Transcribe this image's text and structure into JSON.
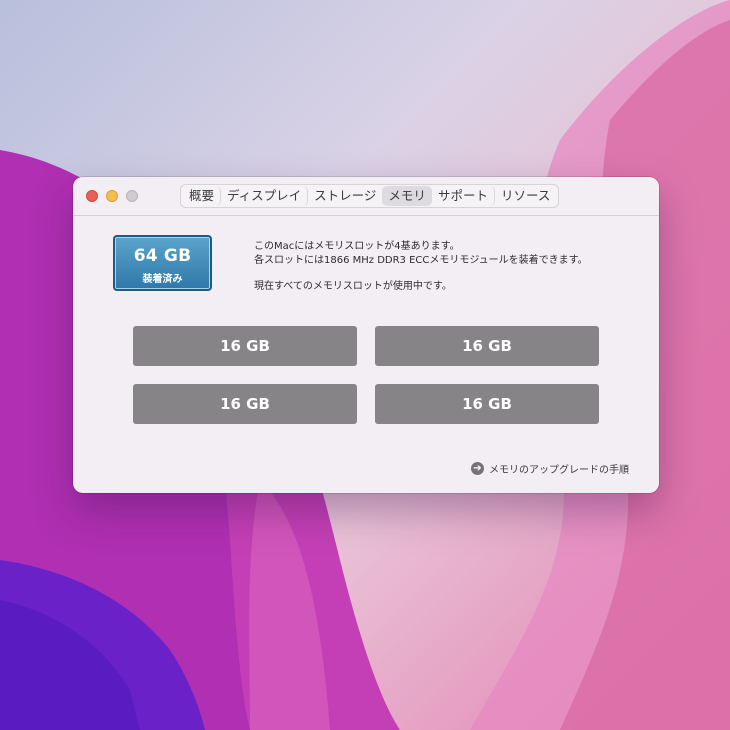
{
  "window": {
    "tabs": [
      {
        "label": "概要",
        "active": false
      },
      {
        "label": "ディスプレイ",
        "active": false
      },
      {
        "label": "ストレージ",
        "active": false
      },
      {
        "label": "メモリ",
        "active": true
      },
      {
        "label": "サポート",
        "active": false
      },
      {
        "label": "リソース",
        "active": false
      }
    ]
  },
  "memory": {
    "total": "64 GB",
    "installed_label": "装着済み",
    "info_line1": "このMacにはメモリスロットが4基あります。",
    "info_line2": "各スロットには1866 MHz DDR3 ECCメモリモジュールを装着できます。",
    "info_line3": "現在すべてのメモリスロットが使用中です。",
    "slots": [
      "16 GB",
      "16 GB",
      "16 GB",
      "16 GB"
    ]
  },
  "upgrade_link": {
    "label": "メモリのアップグレードの手順",
    "icon": "arrow-circle-icon"
  },
  "colors": {
    "badge": "#3a87b6",
    "slot": "#868486",
    "close": "#ec5f56",
    "minimize": "#f4bd4f",
    "zoom_disabled": "#cfcbd0"
  }
}
